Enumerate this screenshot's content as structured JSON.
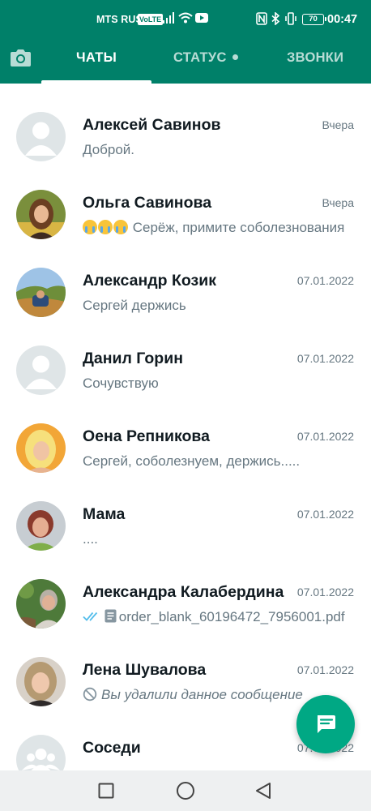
{
  "status_bar": {
    "carrier": "MTS RUS",
    "volte": "VoLTE",
    "battery": "70",
    "time": "00:47"
  },
  "header": {
    "tabs": [
      {
        "label": "ЧАТЫ",
        "active": true
      },
      {
        "label": "СТАТУС",
        "active": false,
        "has_unread_dot": true
      },
      {
        "label": "ЗВОНКИ",
        "active": false
      }
    ]
  },
  "chats": [
    {
      "name": "Алексей Савинов",
      "time": "Вчера",
      "preview": "Доброй.",
      "avatar": "default"
    },
    {
      "name": "Ольга Савинова",
      "time": "Вчера",
      "preview": "Серёж, примите соболезнования",
      "preview_emoji_count": 3,
      "avatar": "photo"
    },
    {
      "name": "Александр Козик",
      "time": "07.01.2022",
      "preview": "Сергей держись",
      "avatar": "photo"
    },
    {
      "name": "Данил Горин",
      "time": "07.01.2022",
      "preview": "Сочувствую",
      "avatar": "default"
    },
    {
      "name": "Оена Репникова",
      "time": "07.01.2022",
      "preview": "Сергей, соболезнуем, держись.....",
      "avatar": "photo"
    },
    {
      "name": "Мама",
      "time": "07.01.2022",
      "preview": "....",
      "avatar": "photo"
    },
    {
      "name": "Александра Калабердина",
      "time": "07.01.2022",
      "preview": "order_blank_60196472_7956001.pdf",
      "read_ticks": true,
      "document_icon": true,
      "avatar": "photo"
    },
    {
      "name": "Лена Шувалова",
      "time": "07.01.2022",
      "preview": "Вы удалили данное сообщение",
      "deleted": true,
      "avatar": "photo"
    },
    {
      "name": "Соседи",
      "time": "07.01.2022",
      "preview": "",
      "avatar": "group"
    }
  ],
  "colors": {
    "header": "#008069",
    "fab": "#00a884",
    "name_text": "#111b21",
    "secondary_text": "#667781",
    "read_ticks": "#53bdeb"
  },
  "icons": {
    "camera": "camera-icon",
    "new_chat": "new-chat-icon",
    "nav_recent": "square-icon",
    "nav_home": "circle-icon",
    "nav_back": "triangle-back-icon"
  }
}
